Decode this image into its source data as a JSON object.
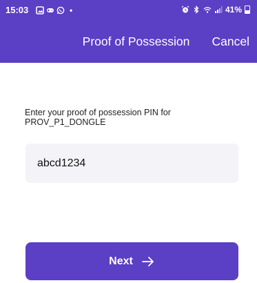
{
  "status_bar": {
    "time": "15:03",
    "battery_percent": "41%",
    "battery_level": 0.41,
    "left_icons": [
      "image-icon",
      "game-icon",
      "whatsapp-icon",
      "notification-dot"
    ],
    "right_icons": [
      "alarm-icon",
      "bluetooth-icon",
      "wifi-icon",
      "signal-icon",
      "battery-icon"
    ]
  },
  "header": {
    "title": "Proof of Possession",
    "cancel_label": "Cancel"
  },
  "form": {
    "prompt": "Enter your proof of possession PIN for PROV_P1_DONGLE",
    "pin_value": "abcd1234"
  },
  "next_button": {
    "label": "Next",
    "icon": "arrow-right-icon"
  },
  "colors": {
    "accent": "#5B3FC4",
    "field_background": "#F4F3F8",
    "text": "#222222"
  }
}
